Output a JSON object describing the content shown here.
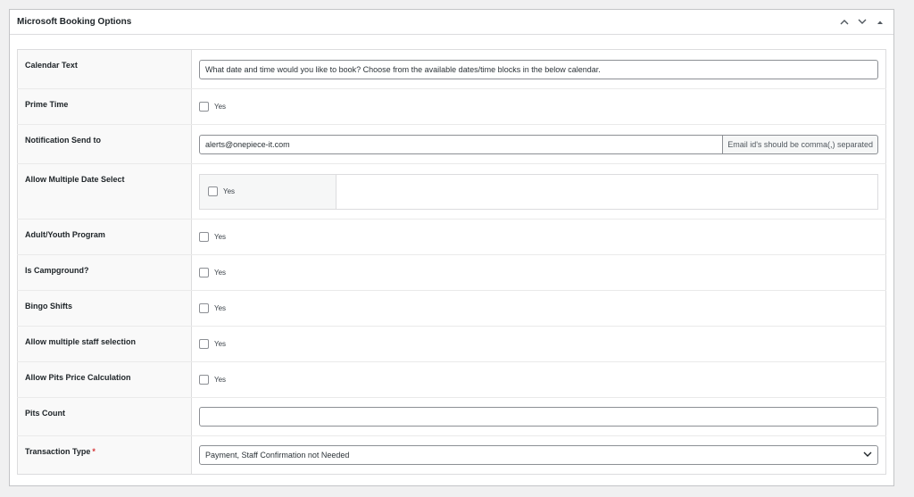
{
  "metabox": {
    "title": "Microsoft Booking Options"
  },
  "icons": {
    "move_up": "chevron-up-icon",
    "move_down": "chevron-down-icon",
    "toggle": "triangle-up-icon"
  },
  "rows": {
    "calendar_text": {
      "label": "Calendar Text",
      "value": "What date and time would you like  to book? Choose from the available  dates/time blocks in the below calendar."
    },
    "prime_time": {
      "label": "Prime Time",
      "option": "Yes"
    },
    "notification": {
      "label": "Notification Send to",
      "value": "alerts@onepiece-it.com",
      "addon": "Email id's should be comma(,) separated"
    },
    "multiple_date": {
      "label": "Allow Multiple Date Select",
      "option": "Yes"
    },
    "adult_youth": {
      "label": "Adult/Youth Program",
      "option": "Yes"
    },
    "campground": {
      "label": "Is Campground?",
      "option": "Yes"
    },
    "bingo": {
      "label": "Bingo Shifts",
      "option": "Yes"
    },
    "multi_staff": {
      "label": "Allow multiple staff selection",
      "option": "Yes"
    },
    "pits_price": {
      "label": "Allow Pits Price Calculation",
      "option": "Yes"
    },
    "pits_count": {
      "label": "Pits Count",
      "value": ""
    },
    "transaction": {
      "label": "Transaction Type",
      "required_mark": "*",
      "value": "Payment, Staff Confirmation not Needed"
    }
  },
  "colors": {
    "required": "#d63638",
    "border": "#8c8f94",
    "background": "#f0f0f1"
  }
}
